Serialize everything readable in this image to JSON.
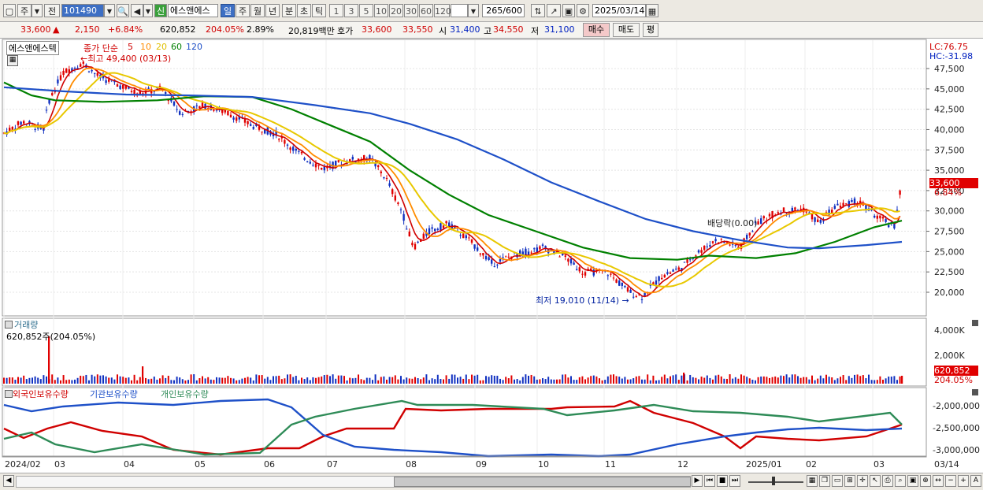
{
  "toolbar": {
    "market": "주",
    "period_sel": "전",
    "code": "101490",
    "stock_name": "에스앤에스",
    "new_badge": "신",
    "periods": [
      "일",
      "주",
      "월",
      "년",
      "분",
      "초",
      "틱"
    ],
    "intervals": [
      "1",
      "3",
      "5",
      "10",
      "20",
      "30",
      "60",
      "120"
    ],
    "count": "265",
    "count_max": "/600",
    "date": "2025/03/14"
  },
  "info": {
    "price": "33,600",
    "change": "2,150",
    "change_pct": "+6.84%",
    "volume": "620,852",
    "vol_ratio": "204.05%",
    "turnover": "2.89%",
    "amount": "20,819백만",
    "ask_label": "호가",
    "ask": "33,600",
    "bid": "33,550",
    "open_label": "시",
    "open": "31,400",
    "high_label": "고",
    "high": "34,550",
    "low_label": "저",
    "low": "31,100",
    "buy": "매수",
    "sell": "매도",
    "eval": "평"
  },
  "price_panel": {
    "name_tag": "에스앤에스텍",
    "legend_title": "종가 단순",
    "ma_labels": [
      "5",
      "10",
      "20",
      "60",
      "120"
    ],
    "ma_colors": [
      "#d00000",
      "#ff8c00",
      "#e8c800",
      "#008000",
      "#1e50c8"
    ],
    "high_note": "←최고 49,400 (03/13)",
    "low_note": "최저 19,010 (11/14) →",
    "div_note": "배당락(0.00)",
    "lc": "LC:76.75",
    "hc": "HC:-31.98",
    "yticks": [
      "47,500",
      "45,000",
      "42,500",
      "40,000",
      "37,500",
      "35,000",
      "32,500",
      "30,000",
      "27,500",
      "25,000",
      "22,500",
      "20,000"
    ],
    "last_price": "33,600",
    "last_pct": "6.84%"
  },
  "volume_panel": {
    "title": "거래량",
    "value": "620,852주(204.05%)",
    "yticks": [
      "4,000K",
      "2,000K"
    ],
    "last_vol": "620,852",
    "last_pct": "204.05%"
  },
  "holder_panel": {
    "legend": [
      "외국인보유수량",
      "기관보유수량",
      "개인보유수량"
    ],
    "colors": [
      "#d00000",
      "#1e50c8",
      "#2e8b57"
    ],
    "yticks": [
      "-2,000,000",
      "-2,500,000",
      "-3,000,000"
    ]
  },
  "xaxis": [
    "2024/02",
    "03",
    "04",
    "05",
    "06",
    "07",
    "08",
    "09",
    "10",
    "11",
    "12",
    "2025/01",
    "02",
    "03"
  ],
  "xaxis_right": "03/14"
}
